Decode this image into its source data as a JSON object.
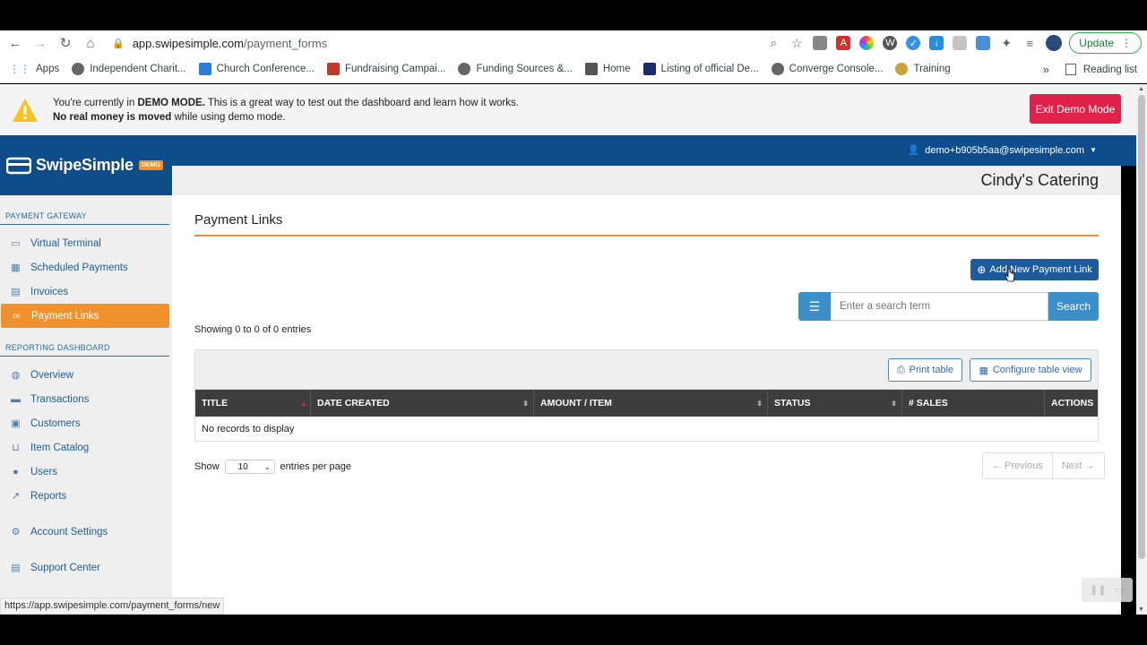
{
  "browser": {
    "url_domain": "app.swipesimple.com",
    "url_path": "/payment_forms",
    "update_label": "Update",
    "bookmarks": [
      "Apps",
      "Independent Charit...",
      "Church Conference...",
      "Fundraising Campai...",
      "Funding Sources &...",
      "Home",
      "Listing of official De...",
      "Converge Console...",
      "Training"
    ],
    "more_label": "»",
    "reading_list": "Reading list",
    "status_url": "https://app.swipesimple.com/payment_forms/new"
  },
  "demo_banner": {
    "line1_prefix": "You're currently in ",
    "line1_bold": "DEMO MODE.",
    "line1_suffix": " This is a great way to test out the dashboard and learn how it works.",
    "line2_bold": "No real money is moved",
    "line2_suffix": " while using demo mode.",
    "exit_label": "Exit Demo Mode"
  },
  "header": {
    "logo": "SwipeSimple",
    "demo_tag": "DEMO",
    "user_email": "demo+b905b5aa@swipesimple.com",
    "company": "Cindy's Catering"
  },
  "sidebar": {
    "section1": "PAYMENT GATEWAY",
    "gateway_items": [
      {
        "label": "Virtual Terminal",
        "icon": "monitor-icon"
      },
      {
        "label": "Scheduled Payments",
        "icon": "calendar-icon"
      },
      {
        "label": "Invoices",
        "icon": "document-icon"
      },
      {
        "label": "Payment Links",
        "icon": "link-icon"
      }
    ],
    "section2": "REPORTING DASHBOARD",
    "report_items": [
      {
        "label": "Overview",
        "icon": "globe-icon"
      },
      {
        "label": "Transactions",
        "icon": "money-icon"
      },
      {
        "label": "Customers",
        "icon": "id-card-icon"
      },
      {
        "label": "Item Catalog",
        "icon": "cart-icon"
      },
      {
        "label": "Users",
        "icon": "users-icon"
      },
      {
        "label": "Reports",
        "icon": "chart-icon"
      }
    ],
    "account_settings": "Account Settings",
    "support_center": "Support Center"
  },
  "main": {
    "page_title": "Payment Links",
    "add_button": "Add New Payment Link",
    "search_placeholder": "Enter a search term",
    "search_button": "Search",
    "showing": "Showing 0 to 0 of 0 entries",
    "print_table": "Print table",
    "configure_view": "Configure table view",
    "columns": [
      "TITLE",
      "DATE CREATED",
      "AMOUNT / ITEM",
      "STATUS",
      "# SALES",
      "ACTIONS"
    ],
    "no_records": "No records to display",
    "show_label": "Show",
    "per_page_value": "10",
    "per_page_suffix": "entries per page",
    "previous": "← Previous",
    "next": "Next →"
  },
  "colors": {
    "brand_blue": "#0f4c8a",
    "accent_orange": "#f0912d",
    "exit_red": "#e0214a"
  }
}
